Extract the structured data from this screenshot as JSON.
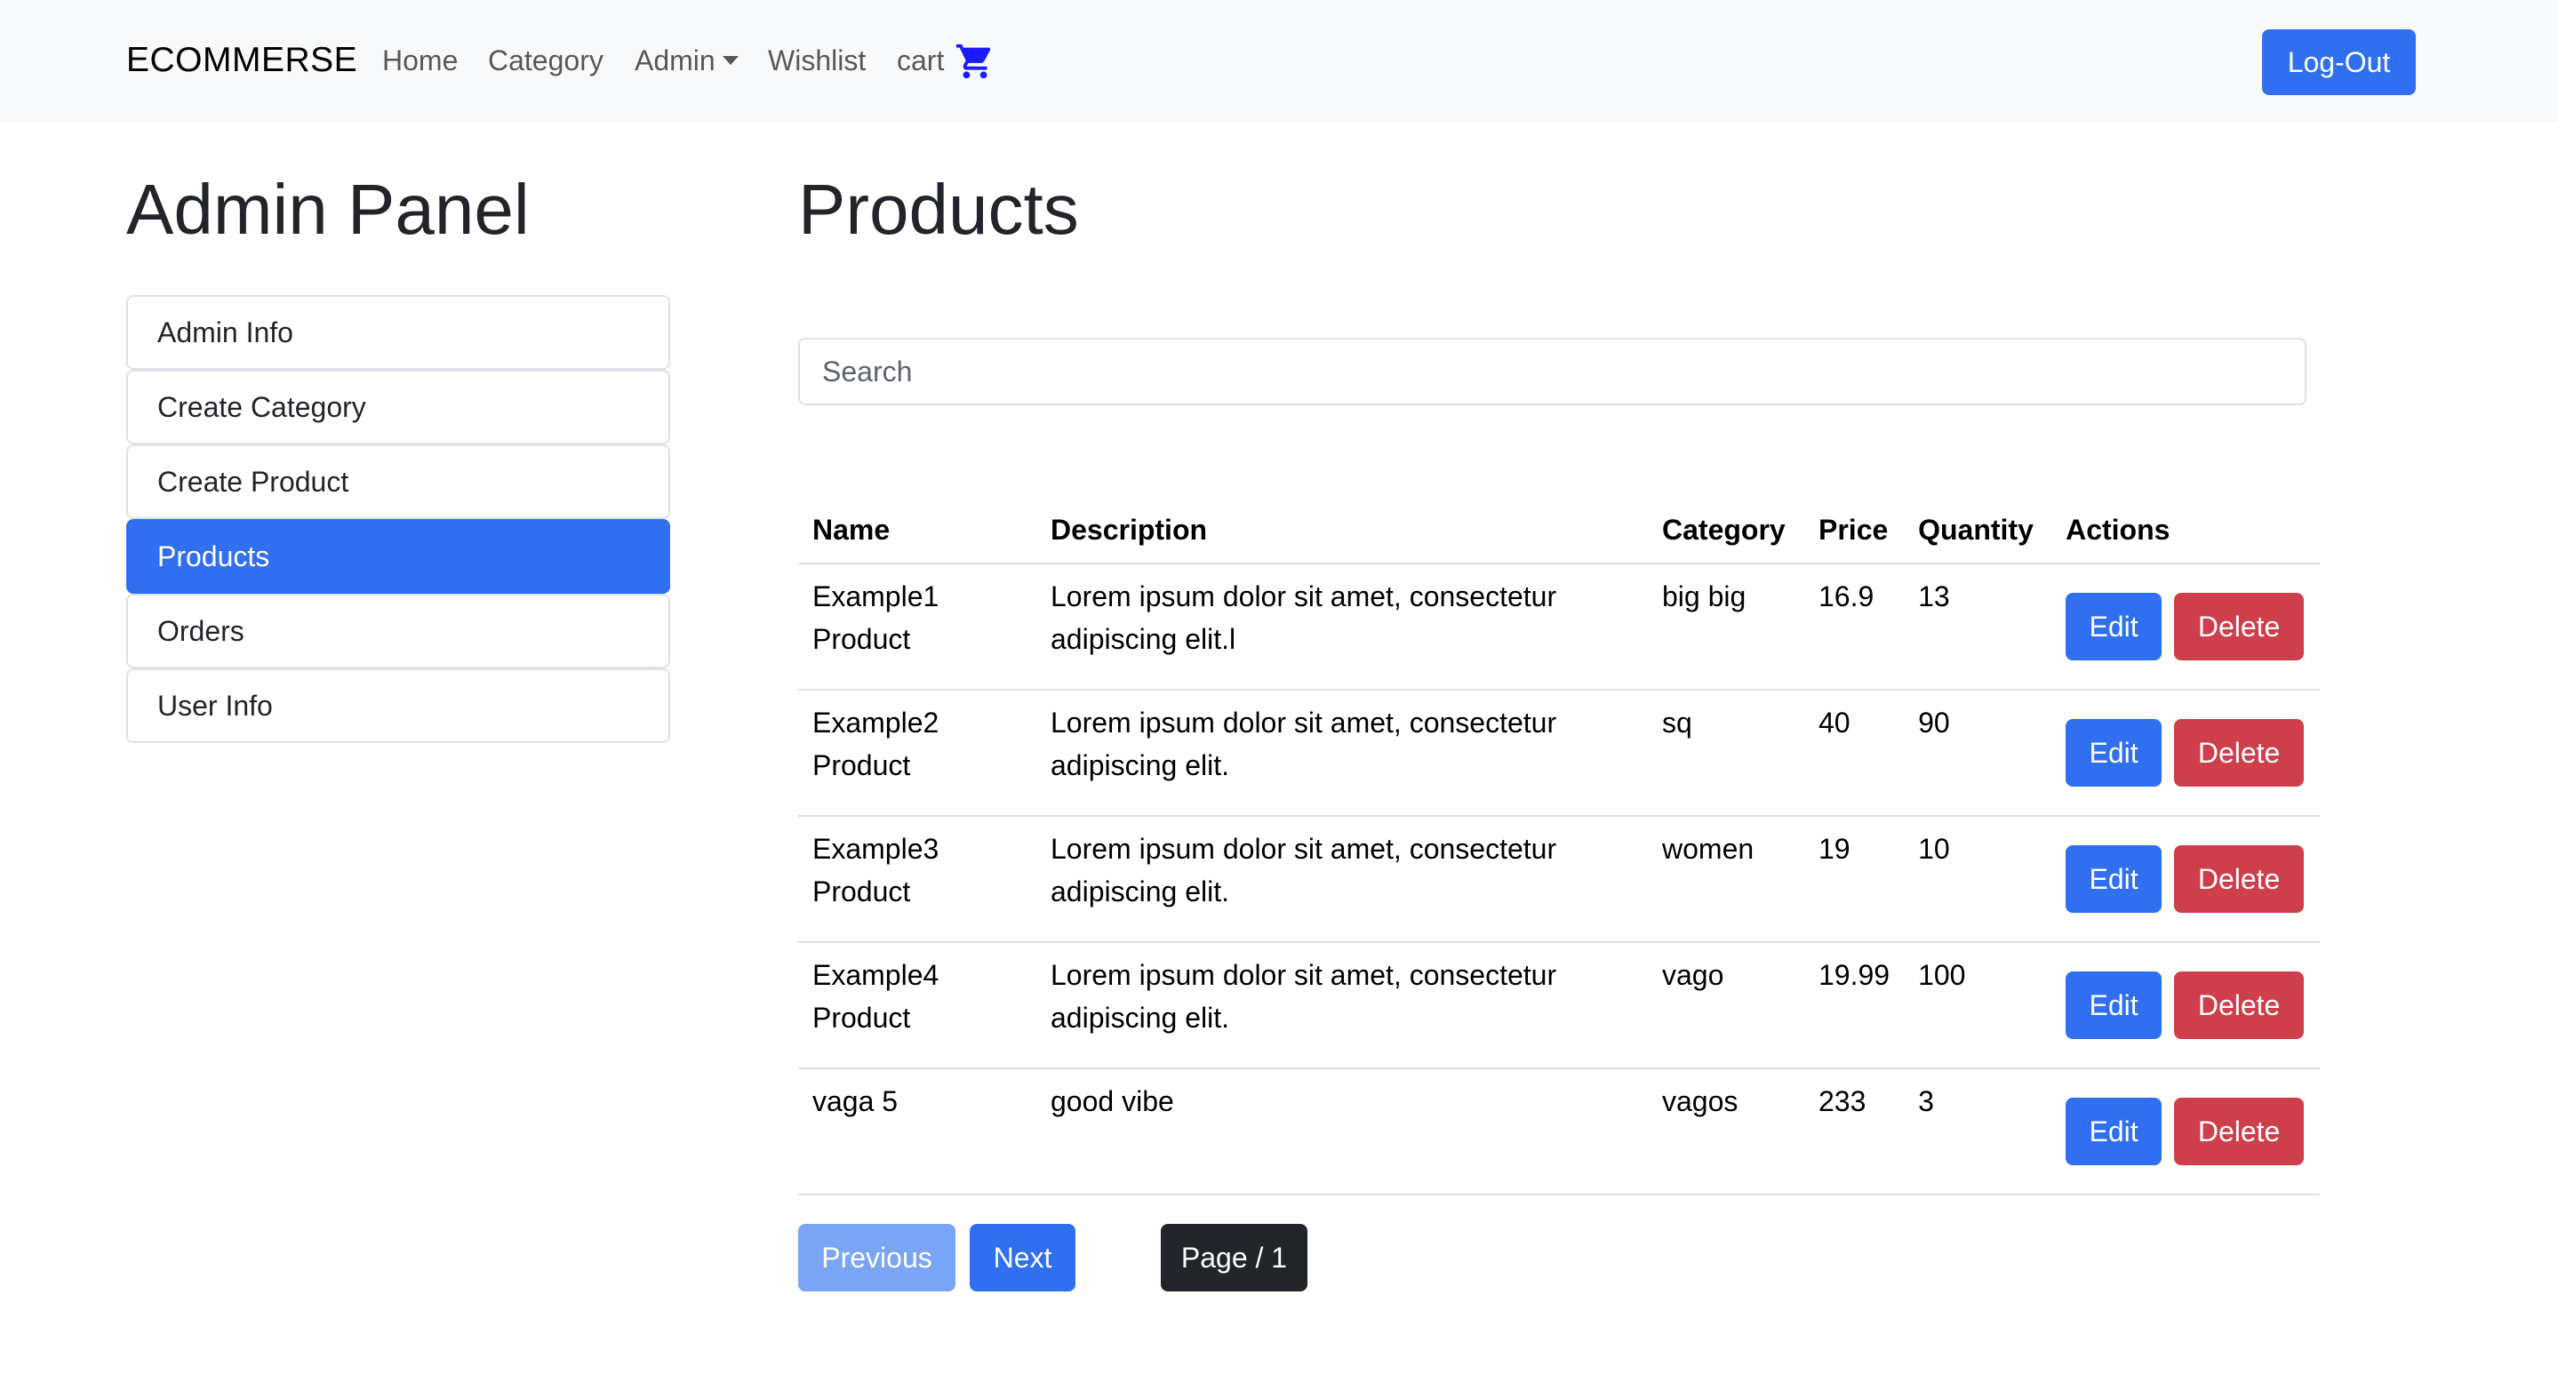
{
  "navbar": {
    "brand": "ECOMMERSE",
    "links": {
      "home": "Home",
      "category": "Category",
      "admin": "Admin",
      "wishlist": "Wishlist",
      "cart": "cart"
    },
    "cart_icon": "shopping-cart-icon",
    "logout_label": "Log-Out"
  },
  "sidebar": {
    "title": "Admin Panel",
    "items": [
      {
        "label": "Admin Info"
      },
      {
        "label": "Create Category"
      },
      {
        "label": "Create Product"
      },
      {
        "label": "Products"
      },
      {
        "label": "Orders"
      },
      {
        "label": "User Info"
      }
    ],
    "active_item": "Products"
  },
  "main": {
    "title": "Products",
    "search": {
      "placeholder": "Search",
      "value": ""
    },
    "table": {
      "headers": [
        "Name",
        "Description",
        "Category",
        "Price",
        "Quantity",
        "Actions"
      ],
      "rows": [
        {
          "name": "Example1 Product",
          "description": "Lorem ipsum dolor sit amet, consectetur adipiscing elit.l",
          "category": "big big",
          "price": "16.9",
          "quantity": "13"
        },
        {
          "name": "Example2 Product",
          "description": "Lorem ipsum dolor sit amet, consectetur adipiscing elit.",
          "category": "sq",
          "price": "40",
          "quantity": "90"
        },
        {
          "name": "Example3 Product",
          "description": "Lorem ipsum dolor sit amet, consectetur adipiscing elit.",
          "category": "women",
          "price": "19",
          "quantity": "10"
        },
        {
          "name": "Example4 Product",
          "description": "Lorem ipsum dolor sit amet, consectetur adipiscing elit.",
          "category": "vago",
          "price": "19.99",
          "quantity": "100"
        },
        {
          "name": "vaga 5",
          "description": "good vibe",
          "category": "vagos",
          "price": "233",
          "quantity": "3"
        }
      ],
      "edit_label": "Edit",
      "delete_label": "Delete"
    },
    "pagination": {
      "previous_label": "Previous",
      "next_label": "Next",
      "page_label": "Page / 1"
    }
  },
  "colors": {
    "primary": "#2f6ff0",
    "danger": "#cf3e4b",
    "dark": "#212529",
    "navbar_bg": "#f8f9fa"
  }
}
